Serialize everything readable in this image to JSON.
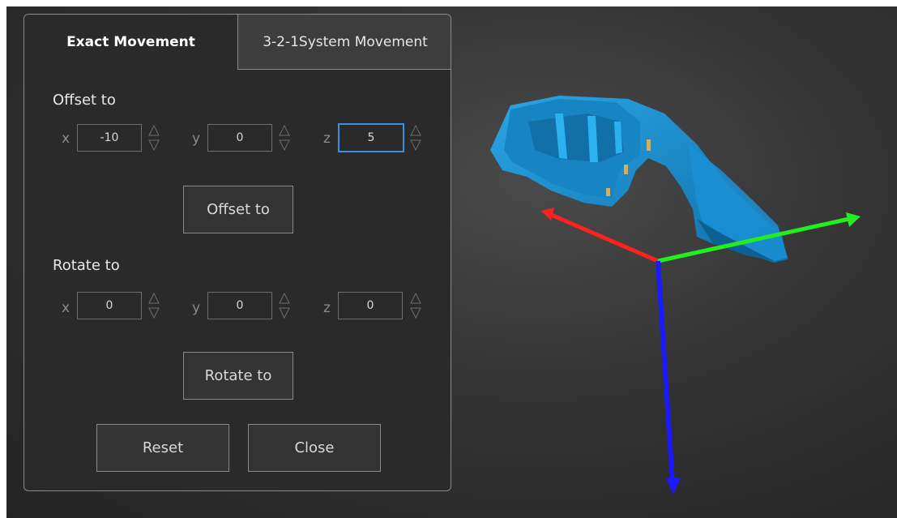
{
  "tabs": {
    "exact": "Exact Movement",
    "system": "3-2-1System  Movement"
  },
  "offset": {
    "section_label": "Offset to",
    "x_label": "x",
    "x_value": "-10",
    "y_label": "y",
    "y_value": "0",
    "z_label": "z",
    "z_value": "5",
    "button": "Offset to"
  },
  "rotate": {
    "section_label": "Rotate to",
    "x_label": "x",
    "x_value": "0",
    "y_label": "y",
    "y_value": "0",
    "z_label": "z",
    "z_value": "0",
    "button": "Rotate to"
  },
  "footer": {
    "reset": "Reset",
    "close": "Close"
  },
  "colors": {
    "focus_border": "#3a8ee6",
    "axis_x": "#ff2020",
    "axis_y": "#22ee22",
    "axis_z": "#1a1aff",
    "model": "#1a8fd0"
  },
  "icons": {
    "spinner": "up-down-arrow-spinner-icon"
  }
}
